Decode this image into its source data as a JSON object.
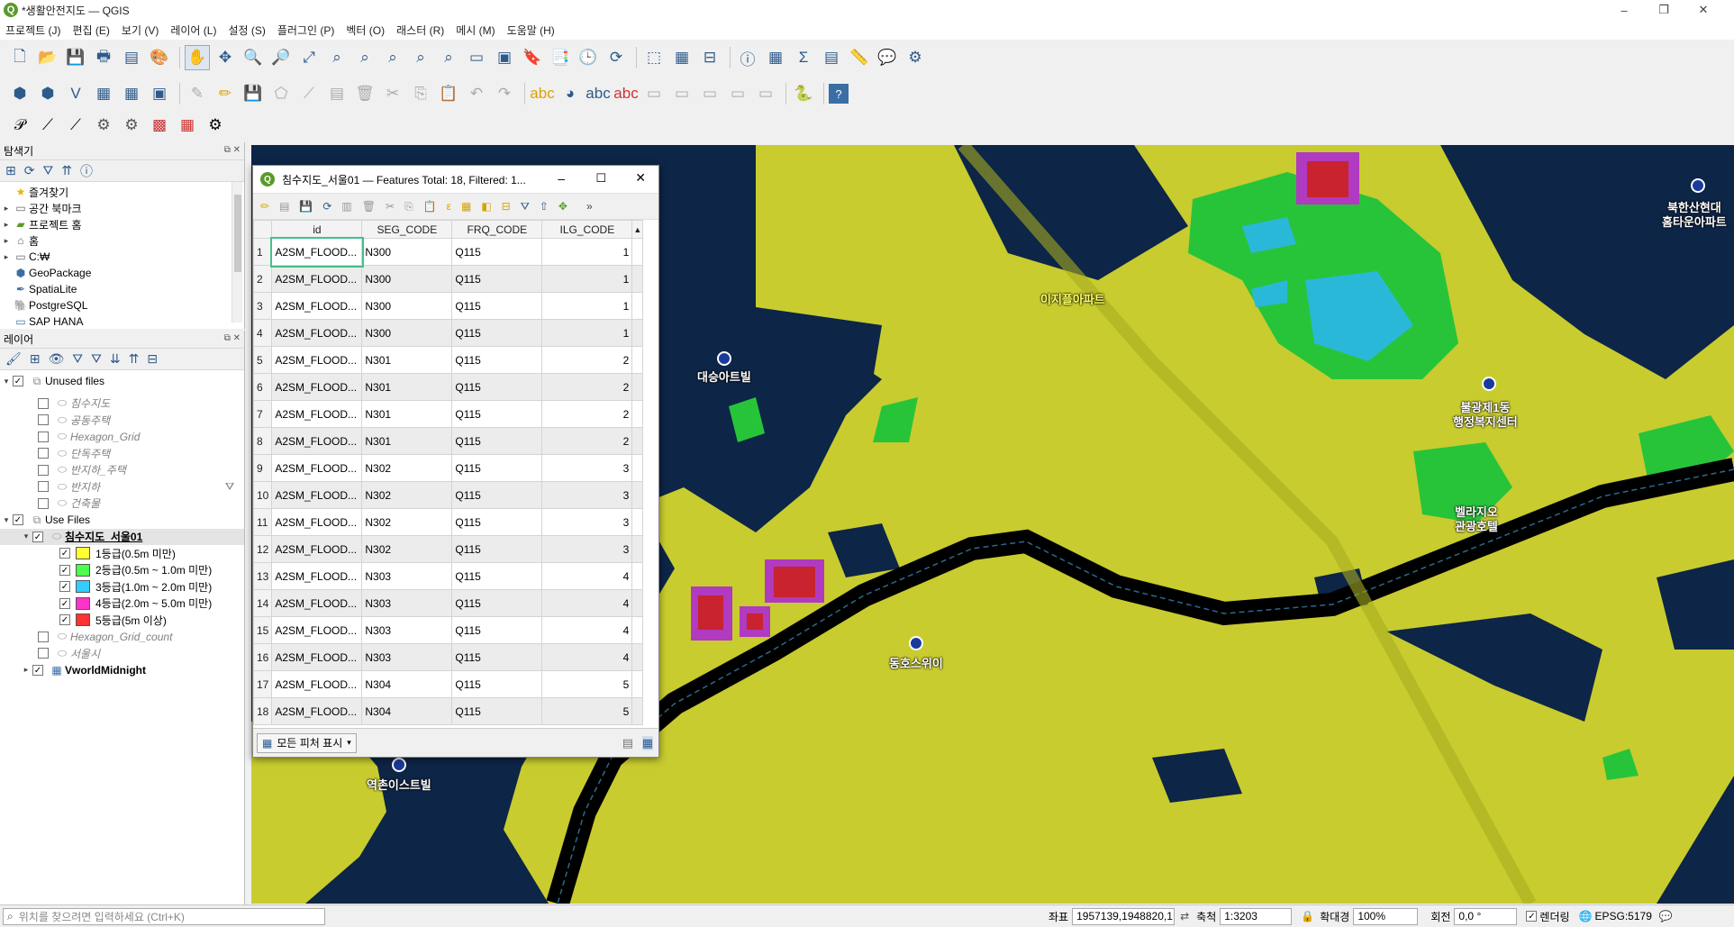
{
  "window": {
    "title": "*생활안전지도 — QGIS",
    "minimize": "–",
    "restore": "❐",
    "close": "✕"
  },
  "menu": [
    "프로젝트 (J)",
    "편집 (E)",
    "보기 (V)",
    "레이어 (L)",
    "설정 (S)",
    "플러그인 (P)",
    "벡터 (O)",
    "래스터 (R)",
    "메시 (M)",
    "도움말 (H)"
  ],
  "browser": {
    "title": "탐색기",
    "items": [
      {
        "label": "즐겨찾기",
        "icon": "star-icon",
        "arrow": ""
      },
      {
        "label": "공간 북마크",
        "icon": "bookmark-icon",
        "arrow": "▸"
      },
      {
        "label": "프로젝트 홈",
        "icon": "project-home-icon",
        "arrow": "▸"
      },
      {
        "label": "홈",
        "icon": "home-icon",
        "arrow": "▸"
      },
      {
        "label": "C:₩",
        "icon": "drive-icon",
        "arrow": "▸"
      },
      {
        "label": "GeoPackage",
        "icon": "geopackage-icon",
        "arrow": ""
      },
      {
        "label": "SpatiaLite",
        "icon": "spatialite-icon",
        "arrow": ""
      },
      {
        "label": "PostgreSQL",
        "icon": "postgresql-icon",
        "arrow": ""
      },
      {
        "label": "SAP HANA",
        "icon": "saphana-icon",
        "arrow": ""
      }
    ]
  },
  "layers": {
    "title": "레이어",
    "groups": {
      "unused": "Unused files",
      "use": "Use Files"
    },
    "unused_items": [
      {
        "label": "침수지도",
        "filter": false
      },
      {
        "label": "공동주택",
        "filter": false
      },
      {
        "label": "Hexagon_Grid",
        "filter": false
      },
      {
        "label": "단독주택",
        "filter": false
      },
      {
        "label": "반지하_주택",
        "filter": false
      },
      {
        "label": "반지하",
        "filter": true
      },
      {
        "label": "건축물",
        "filter": false
      }
    ],
    "active_layer": "침수지도_서울01",
    "legend": [
      {
        "label": "1등급(0.5m 미만)",
        "color": "#ffff33"
      },
      {
        "label": "2등급(0.5m ~ 1.0m 미만)",
        "color": "#4dff4d"
      },
      {
        "label": "3등급(1.0m ~ 2.0m 미만)",
        "color": "#33ccff"
      },
      {
        "label": "4등급(2.0m ~ 5.0m 미만)",
        "color": "#ff33cc"
      },
      {
        "label": "5등급(5m 이상)",
        "color": "#ff3333"
      }
    ],
    "after": [
      {
        "label": "Hexagon_Grid_count"
      },
      {
        "label": "서울시"
      }
    ],
    "basemap": "VworldMidnight"
  },
  "attribute_table": {
    "title": "침수지도_서울01 — Features Total: 18, Filtered: 1...",
    "columns": [
      "id",
      "SEG_CODE",
      "FRQ_CODE",
      "ILG_CODE"
    ],
    "rows": [
      [
        "1",
        "A2SM_FLOOD...",
        "N300",
        "Q115",
        "1"
      ],
      [
        "2",
        "A2SM_FLOOD...",
        "N300",
        "Q115",
        "1"
      ],
      [
        "3",
        "A2SM_FLOOD...",
        "N300",
        "Q115",
        "1"
      ],
      [
        "4",
        "A2SM_FLOOD...",
        "N300",
        "Q115",
        "1"
      ],
      [
        "5",
        "A2SM_FLOOD...",
        "N301",
        "Q115",
        "2"
      ],
      [
        "6",
        "A2SM_FLOOD...",
        "N301",
        "Q115",
        "2"
      ],
      [
        "7",
        "A2SM_FLOOD...",
        "N301",
        "Q115",
        "2"
      ],
      [
        "8",
        "A2SM_FLOOD...",
        "N301",
        "Q115",
        "2"
      ],
      [
        "9",
        "A2SM_FLOOD...",
        "N302",
        "Q115",
        "3"
      ],
      [
        "10",
        "A2SM_FLOOD...",
        "N302",
        "Q115",
        "3"
      ],
      [
        "11",
        "A2SM_FLOOD...",
        "N302",
        "Q115",
        "3"
      ],
      [
        "12",
        "A2SM_FLOOD...",
        "N302",
        "Q115",
        "3"
      ],
      [
        "13",
        "A2SM_FLOOD...",
        "N303",
        "Q115",
        "4"
      ],
      [
        "14",
        "A2SM_FLOOD...",
        "N303",
        "Q115",
        "4"
      ],
      [
        "15",
        "A2SM_FLOOD...",
        "N303",
        "Q115",
        "4"
      ],
      [
        "16",
        "A2SM_FLOOD...",
        "N303",
        "Q115",
        "4"
      ],
      [
        "17",
        "A2SM_FLOOD...",
        "N304",
        "Q115",
        "5"
      ],
      [
        "18",
        "A2SM_FLOOD...",
        "N304",
        "Q115",
        "5"
      ]
    ],
    "footer_button": "모든 피처 표시"
  },
  "map_labels": {
    "l1": "이지플아파트",
    "l2": "대승아트빌",
    "l3": "북한산현대\n홈타운아파트",
    "l4": "불광제1동\n행정복지센터",
    "l5": "벨라지오\n관광호텔",
    "l6": "동호스위이",
    "l7": "역촌이스트빌"
  },
  "status": {
    "search_placeholder": "위치를 찾으려면 입력하세요 (Ctrl+K)",
    "coord_label": "좌표",
    "coord_value": "1957139,1948820,1",
    "scale_label": "축척",
    "scale_value": "1:3203",
    "magnifier_label": "확대경",
    "magnifier_value": "100%",
    "rotation_label": "회전",
    "rotation_value": "0,0 °",
    "render_label": "렌더링",
    "crs": "EPSG:5179"
  }
}
